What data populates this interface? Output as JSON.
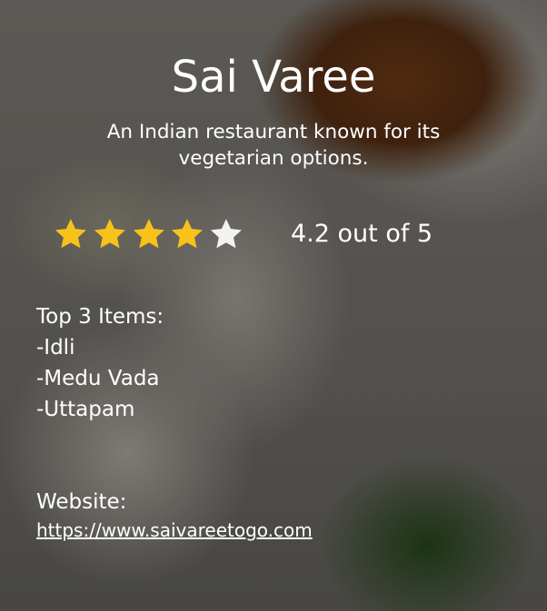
{
  "restaurant": {
    "name": "Sai Varee",
    "description": "An Indian restaurant known for its vegetarian options."
  },
  "rating": {
    "value": 4.2,
    "text": "4.2 out of 5",
    "max_stars": 5,
    "filled_stars": 4,
    "star_color": "#f7c21b",
    "empty_star_color": "#f2f2f2"
  },
  "top_items": {
    "heading": "Top 3 Items:",
    "items": [
      "-Idli",
      "-Medu Vada",
      "-Uttapam"
    ]
  },
  "website": {
    "label": "Website:",
    "url": "https://www.saivareetogo.com"
  }
}
